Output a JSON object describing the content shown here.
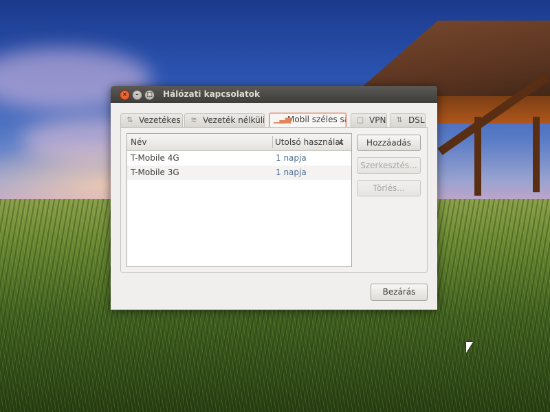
{
  "window": {
    "title": "Hálózati kapcsolatok",
    "controls": {
      "close": "×",
      "minimize": "–",
      "maximize": "□"
    }
  },
  "tabs": [
    {
      "label": "Vezetékes",
      "icon": "wired-arrows-icon"
    },
    {
      "label": "Vezeték nélküli",
      "icon": "wifi-icon"
    },
    {
      "label": "Mobil széles sáv",
      "icon": "signal-bars-icon",
      "active": true
    },
    {
      "label": "VPN",
      "icon": "lock-icon"
    },
    {
      "label": "DSL",
      "icon": "dsl-arrows-icon"
    }
  ],
  "list": {
    "columns": {
      "name": "Név",
      "last_used": "Utolsó használat"
    },
    "sort_indicator": "▲",
    "rows": [
      {
        "name": "T-Mobile 4G",
        "last_used": "1 napja"
      },
      {
        "name": "T-Mobile 3G",
        "last_used": "1 napja"
      }
    ]
  },
  "buttons": {
    "add": "Hozzáadás",
    "edit": "Szerkesztés...",
    "delete": "Törlés...",
    "close": "Bezárás"
  },
  "colors": {
    "active_tab_border": "#e0865a",
    "titlebar": "#3e3d3a",
    "close_button": "#d84a16",
    "last_used_text": "#4f6c8f"
  }
}
